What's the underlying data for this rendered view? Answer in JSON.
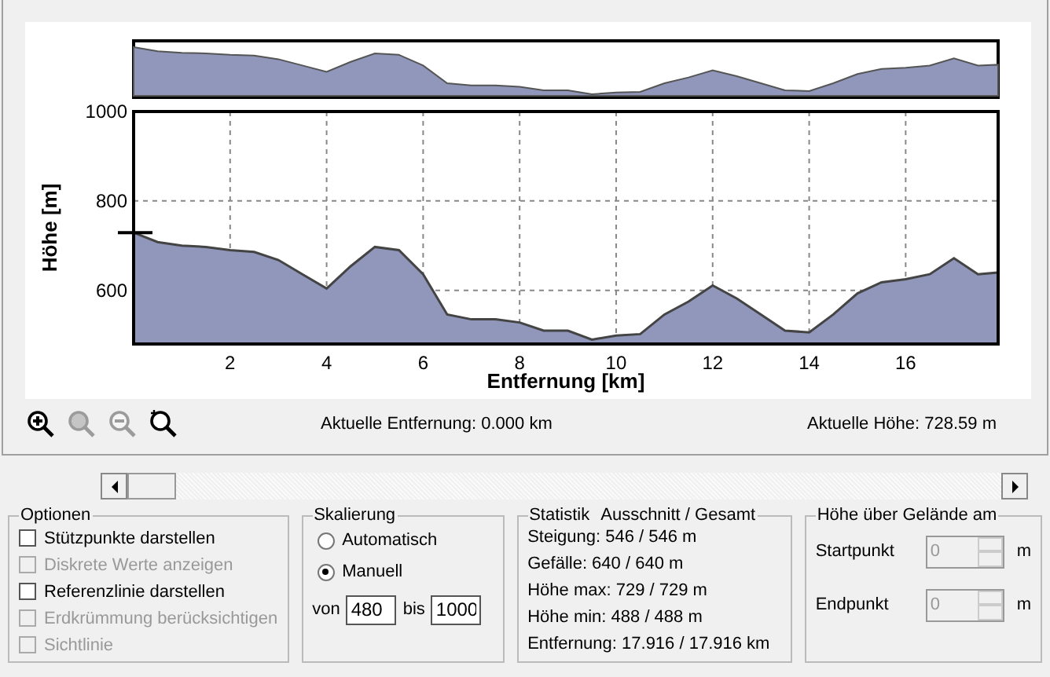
{
  "chart": {
    "chart_data": {
      "type": "area",
      "xlabel": "Entfernung [km]",
      "ylabel": "Höhe [m]",
      "x": [
        0,
        0.5,
        1,
        1.5,
        2,
        2.5,
        3,
        3.5,
        4,
        4.5,
        5,
        5.5,
        6,
        6.5,
        7,
        7.5,
        8,
        8.5,
        9,
        9.5,
        10,
        10.5,
        11,
        11.5,
        12,
        12.5,
        13,
        13.5,
        14,
        14.5,
        15,
        15.5,
        16,
        16.5,
        17,
        17.5,
        17.916
      ],
      "series": [
        {
          "color": "#9097bb",
          "values": [
            729,
            708,
            700,
            697,
            690,
            686,
            668,
            636,
            604,
            654,
            697,
            690,
            636,
            546,
            535,
            535,
            528,
            510,
            510,
            490,
            499,
            502,
            546,
            575,
            611,
            582,
            546,
            510,
            506,
            546,
            593,
            618,
            625,
            636,
            672,
            636,
            640
          ]
        }
      ],
      "xlim": [
        0,
        17.916
      ],
      "ylim": [
        480,
        1000
      ],
      "xticks": [
        2,
        4,
        6,
        8,
        10,
        12,
        14,
        16
      ],
      "yticks": [
        600,
        800,
        1000
      ],
      "grid": true
    }
  },
  "zoom_tools": [
    {
      "kind": "zoom-in",
      "disabled": false
    },
    {
      "kind": "zoom-box",
      "disabled": true
    },
    {
      "kind": "zoom-out",
      "disabled": true
    },
    {
      "kind": "zoom-reset",
      "disabled": false
    }
  ],
  "current_distance": "Aktuelle Entfernung: 0.000 km",
  "current_height": "Aktuelle Höhe: 728.59 m",
  "options": {
    "title": "Optionen",
    "items": [
      {
        "label": "Stützpunkte darstellen",
        "checked": false,
        "disabled": false
      },
      {
        "label": "Diskrete Werte anzeigen",
        "checked": false,
        "disabled": true
      },
      {
        "label": "Referenzlinie darstellen",
        "checked": false,
        "disabled": false
      },
      {
        "label": "Erdkrümmung berücksichtigen",
        "checked": false,
        "disabled": true
      },
      {
        "label": "Sichtlinie",
        "checked": false,
        "disabled": true
      }
    ]
  },
  "scaling": {
    "title": "Skalierung",
    "options": [
      {
        "label": "Automatisch",
        "selected": false
      },
      {
        "label": "Manuell",
        "selected": true
      }
    ],
    "from_label": "von",
    "from_value": "480",
    "to_label": "bis",
    "to_value": "1000"
  },
  "statistics": {
    "title": "Statistik",
    "subtitle": "Ausschnitt / Gesamt",
    "lines": [
      "Steigung: 546 / 546 m",
      "Gefälle: 640 / 640 m",
      "Höhe max: 729 / 729 m",
      "Höhe min: 488 / 488 m",
      "Entfernung: 17.916 / 17.916 km"
    ]
  },
  "height_above_ground": {
    "title": "Höhe über Gelände am",
    "fields": [
      {
        "label": "Startpunkt",
        "value": "0",
        "unit": "m",
        "disabled": true
      },
      {
        "label": "Endpunkt",
        "value": "0",
        "unit": "m",
        "disabled": true
      }
    ]
  }
}
